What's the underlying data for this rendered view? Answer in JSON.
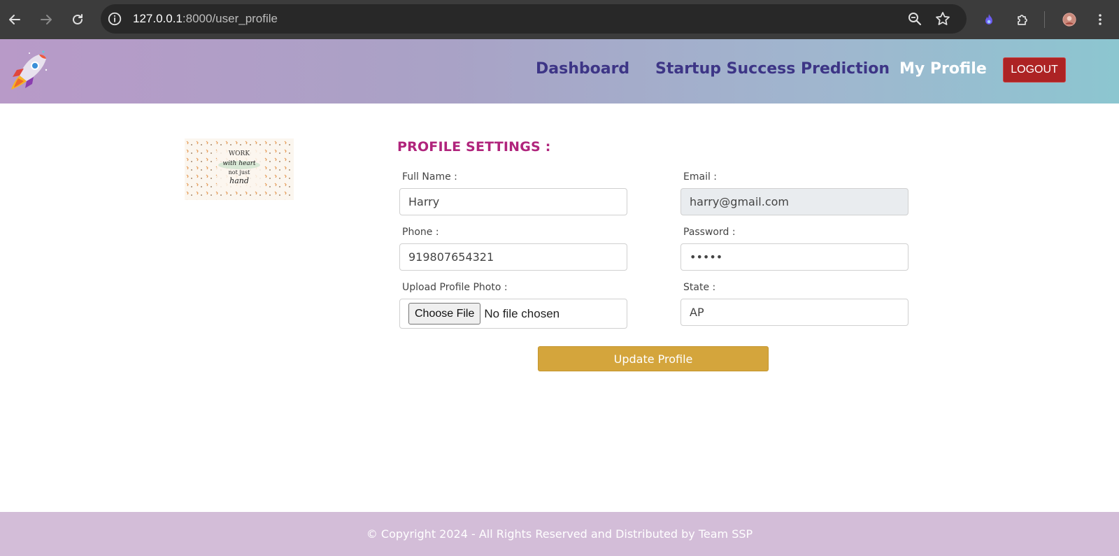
{
  "browser": {
    "url_host": "127.0.0.1",
    "url_path": ":8000/user_profile",
    "icons": [
      "back-icon",
      "forward-icon",
      "reload-icon",
      "site-info-icon",
      "zoom-icon",
      "bookmark-star-icon",
      "extension-flame-icon",
      "extensions-puzzle-icon",
      "profile-avatar-icon",
      "more-menu-icon"
    ]
  },
  "nav": {
    "dashboard": "Dashboard",
    "prediction": "Startup Success Prediction",
    "profile": "My Profile",
    "logout": "LOGOUT"
  },
  "profile_image": {
    "text_lines": [
      "WORK",
      "with heart",
      "not just",
      "hand"
    ]
  },
  "form": {
    "title": "PROFILE SETTINGS :",
    "full_name_label": "Full Name :",
    "full_name_value": "Harry",
    "email_label": "Email :",
    "email_value": "harry@gmail.com",
    "phone_label": "Phone :",
    "phone_value": "919807654321",
    "password_label": "Password :",
    "password_value": "•••••",
    "photo_label": "Upload Profile Photo :",
    "choose_file_label": "Choose File",
    "file_status": "No file chosen",
    "state_label": "State :",
    "state_value": "AP",
    "submit_label": "Update Profile"
  },
  "footer": {
    "copyright": "© Copyright 2024 - All Rights Reserved and Distributed by Team SSP"
  },
  "colors": {
    "nav_link": "#3d3586",
    "nav_active": "#ffffff",
    "logout_bg": "#ad2324",
    "title": "#b0247c",
    "submit_bg": "#d4a53c",
    "footer_bg": "#d3bdd8"
  }
}
